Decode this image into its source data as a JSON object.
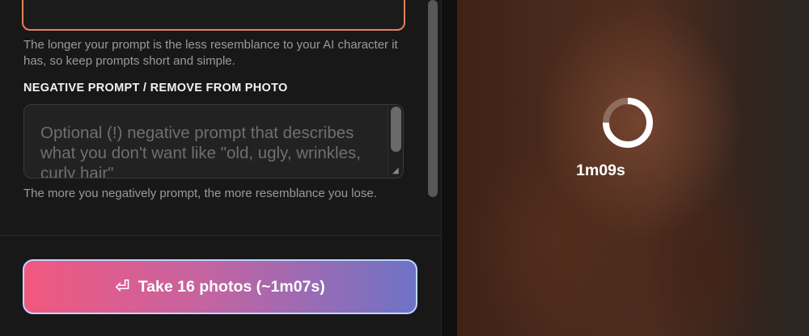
{
  "form": {
    "prompt_help": "The longer your prompt is the less resemblance to your AI character it has, so keep prompts short and simple.",
    "negative_label": "NEGATIVE PROMPT / REMOVE FROM PHOTO",
    "negative_placeholder": "Optional (!) negative prompt that describes what you don't want like \"old, ugly, wrinkles, curly hair\"",
    "negative_help": "The more you negatively prompt, the more resemblance you lose."
  },
  "cta": {
    "icon": "return-arrow-icon",
    "label": "Take 16 photos (~1m07s)",
    "colors": {
      "start": "#f2587f",
      "end": "#6e73c6",
      "border": "#bcd6ff"
    }
  },
  "preview": {
    "timer": "1m09s",
    "spinner_progress": 0.75
  },
  "colors": {
    "prompt_border": "#e4805d",
    "background": "#181818"
  }
}
